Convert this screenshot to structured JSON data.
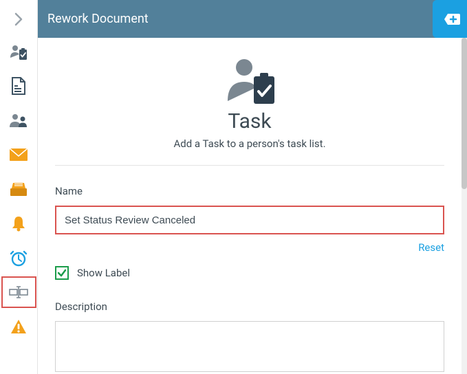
{
  "header": {
    "title": "Rework Document"
  },
  "hero": {
    "title": "Task",
    "subtitle": "Add a Task to a person's task list."
  },
  "form": {
    "name_label": "Name",
    "name_value": "Set Status Review Canceled",
    "reset": "Reset",
    "show_label": "Show Label",
    "description_label": "Description",
    "description_value": ""
  },
  "sidebar": {
    "items": [
      "chevron-right",
      "clipboard-person",
      "document",
      "people",
      "mail",
      "inbox",
      "bell",
      "clock",
      "form-field",
      "warning"
    ]
  }
}
